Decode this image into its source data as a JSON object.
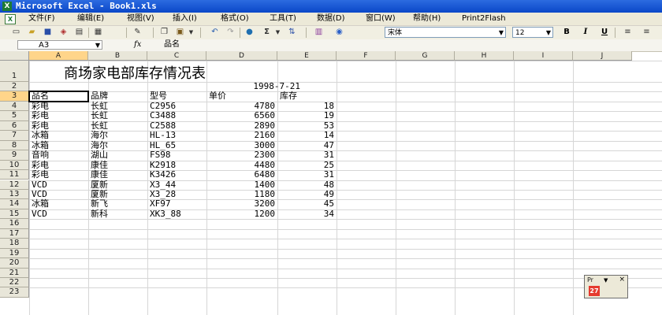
{
  "window": {
    "title": "Microsoft Excel - Book1.xls"
  },
  "menu": [
    "文件(F)",
    "编辑(E)",
    "视图(V)",
    "插入(I)",
    "格式(O)",
    "工具(T)",
    "数据(D)",
    "窗口(W)",
    "帮助(H)",
    "Print2Flash"
  ],
  "toolbar": {
    "font_name": "宋体",
    "font_size": "12",
    "sigma": "Σ",
    "bold": "B",
    "italic": "I",
    "underline": "U"
  },
  "formula_bar": {
    "name_box": "A3",
    "fx": "fx",
    "value": "品名"
  },
  "columns": [
    "A",
    "B",
    "C",
    "D",
    "E",
    "F",
    "G",
    "H",
    "I",
    "J"
  ],
  "rows": [
    "1",
    "2",
    "3",
    "4",
    "5",
    "6",
    "7",
    "8",
    "9",
    "10",
    "11",
    "12",
    "13",
    "14",
    "15",
    "16",
    "17",
    "18",
    "19",
    "20",
    "21",
    "22",
    "23"
  ],
  "sheet": {
    "title": "商场家电部库存情况表",
    "date": "1998-7-21",
    "headers": [
      "品名",
      "品牌",
      "型号",
      "单价",
      "库存"
    ],
    "records": [
      [
        "彩电",
        "长虹",
        "C2956",
        "4780",
        "18"
      ],
      [
        "彩电",
        "长虹",
        "C3488",
        "6560",
        "19"
      ],
      [
        "彩电",
        "长虹",
        "C2588",
        "2890",
        "53"
      ],
      [
        "冰箱",
        "海尔",
        "HL-13",
        "2160",
        "14"
      ],
      [
        "冰箱",
        "海尔",
        "HL_65",
        "3000",
        "47"
      ],
      [
        "音响",
        "湖山",
        "FS98",
        "2300",
        "31"
      ],
      [
        "彩电",
        "康佳",
        "K2918",
        "4480",
        "25"
      ],
      [
        "彩电",
        "康佳",
        "K3426",
        "6480",
        "31"
      ],
      [
        "VCD",
        "厦新",
        "X3_44",
        "1400",
        "48"
      ],
      [
        "VCD",
        "厦新",
        "X3_28",
        "1180",
        "49"
      ],
      [
        "冰箱",
        "新飞",
        "XF97",
        "3200",
        "45"
      ],
      [
        "VCD",
        "新科",
        "XK3_88",
        "1200",
        "34"
      ]
    ]
  },
  "float_toolbar": {
    "title": "Pr",
    "menu": "▼",
    "close": "×",
    "button": "27"
  },
  "icons": [
    "excel-app-icon",
    "new-icon",
    "open-icon",
    "save-icon",
    "print-icon",
    "cut-icon",
    "copy-icon",
    "paste-icon",
    "undo-icon",
    "autosum-icon",
    "sort-icon",
    "chart-icon",
    "help-icon",
    "align-left-icon",
    "align-center-icon"
  ]
}
